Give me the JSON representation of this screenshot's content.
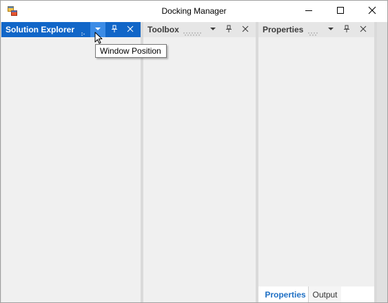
{
  "window": {
    "title": "Docking Manager"
  },
  "icons": {
    "app": "app-window-icon",
    "minimize": "minimize-icon",
    "maximize": "maximize-icon",
    "close": "close-icon",
    "dropdown": "chevron-down-icon",
    "pin": "pin-icon",
    "panel_close": "close-icon"
  },
  "panels": [
    {
      "title": "Solution Explorer",
      "active": true
    },
    {
      "title": "Toolbox",
      "active": false
    },
    {
      "title": "Properties",
      "active": false
    }
  ],
  "tabs": [
    {
      "label": "Properties",
      "selected": true
    },
    {
      "label": "Output",
      "selected": false
    }
  ],
  "tooltip": {
    "text": "Window Position"
  },
  "colors": {
    "active_caption": "#1166c8",
    "hot_button": "#3c8ce6",
    "inactive_caption": "#e6e6e6",
    "panel_bg": "#f0f0f0",
    "selected_tab_text": "#1e6fc4"
  }
}
